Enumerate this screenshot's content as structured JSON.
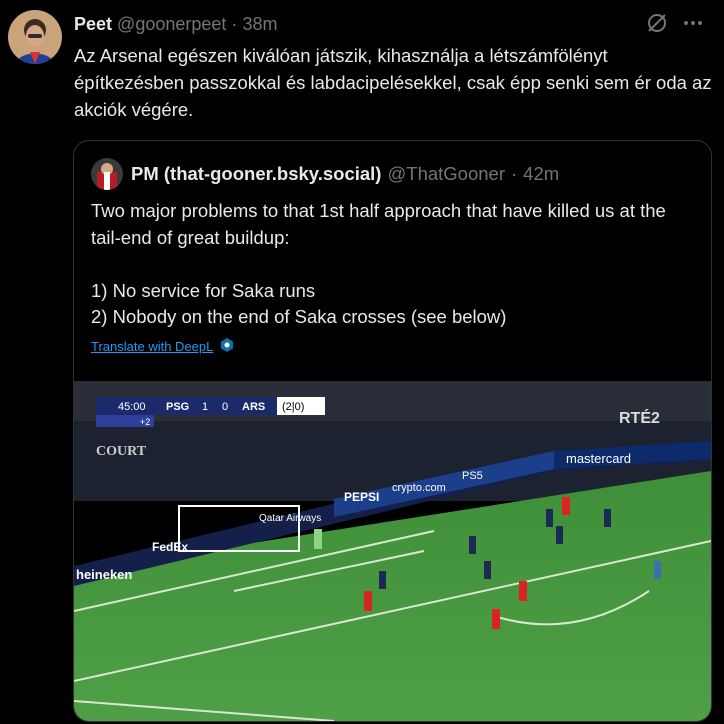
{
  "post": {
    "author_name": "Peet",
    "author_handle": "@goonerpeet",
    "separator": "·",
    "time": "38m",
    "icons": [
      "no-translate-icon",
      "more-icon"
    ],
    "text": "Az Arsenal egészen kiválóan játszik, kihasználja a létszámfölényt építkezésben passzokkal és labdacipelésekkel, csak épp senki sem ér oda az akciók végére."
  },
  "quote": {
    "author_name": "PM (that-gooner.bsky.social)",
    "author_handle": "@ThatGooner",
    "separator": "·",
    "time": "42m",
    "lines": [
      "Two major problems to that 1st half approach that have killed us at the tail-end of great buildup:",
      "",
      "1) No service for Saka runs",
      "2) Nobody on the end of Saka crosses (see below)"
    ],
    "translate_label": "Translate with DeepL"
  },
  "media": {
    "scorebug": {
      "clock": "45:00",
      "added_time": "+2",
      "home": "PSG",
      "home_score": "1",
      "away_score": "0",
      "away": "ARS",
      "aggregate": "(2|0)"
    },
    "broadcaster": "RTÉ2",
    "boards": [
      "Qatar Airways",
      "PEPSI",
      "crypto.com",
      "PS5",
      "mastercard",
      "FedEx",
      "heineken",
      "COURT"
    ]
  },
  "colors": {
    "background": "#000000",
    "text": "#e7e9ea",
    "muted": "#71767b",
    "link": "#1d9bf0",
    "border": "#2f3336"
  }
}
